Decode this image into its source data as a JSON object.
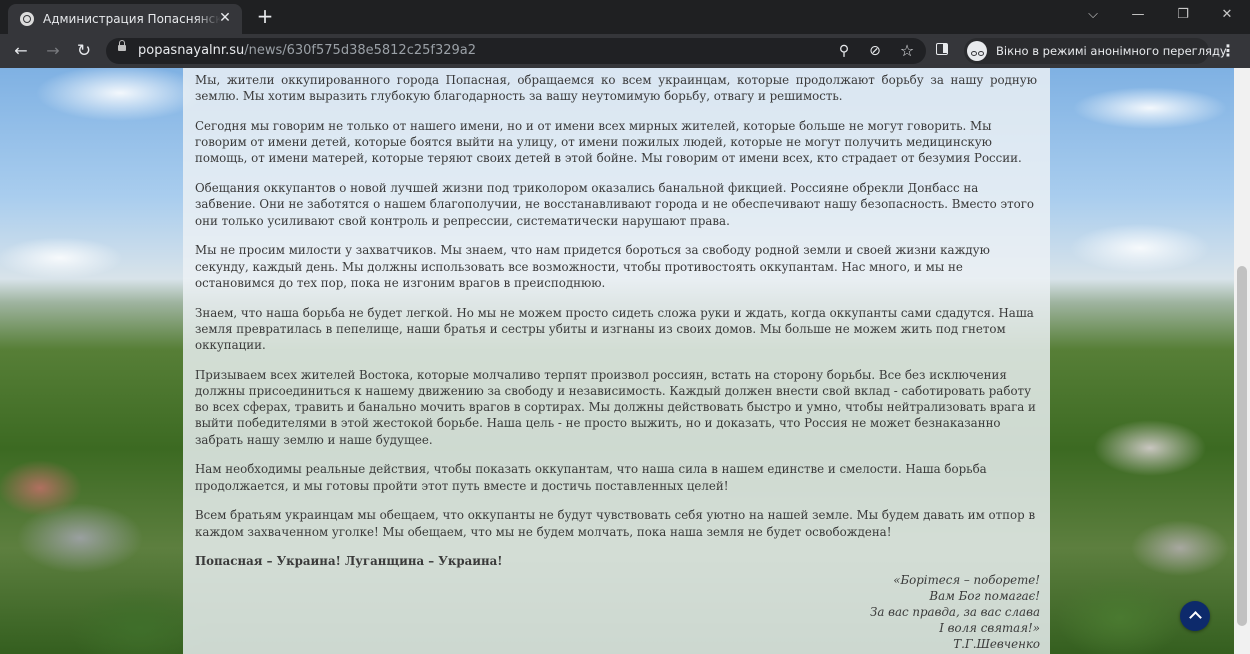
{
  "browser": {
    "tab_title": "Администрация Попаснянского",
    "close_glyph": "✕",
    "new_tab_glyph": "+",
    "url_host": "popasnayalnr.su",
    "url_path": "/news/630f575d38e5812c25f329a2",
    "incognito_label": "Вікно в режимі анонімного перегляду",
    "window_controls": {
      "chevron": "⌵",
      "minimize": "—",
      "restore": "❐",
      "close": "✕"
    },
    "icons": {
      "back": "←",
      "forward": "→",
      "reload": "↻",
      "search": "⚲",
      "eye_off": "⊘",
      "star": "☆",
      "menu": "⋮"
    }
  },
  "article": {
    "paragraphs": [
      "Мы, жители оккупированного города Попасная, обращаемся ко всем украинцам, которые продолжают борьбу за нашу родную землю. Мы хотим выразить глубокую благодарность за вашу неутомимую борьбу, отвагу и решимость.",
      "Сегодня мы говорим не только от нашего имени, но и от имени всех мирных жителей, которые больше не могут говорить. Мы говорим от имени детей, которые боятся выйти на улицу, от имени пожилых людей, которые не могут получить медицинскую помощь, от имени матерей, которые теряют своих детей в этой бойне. Мы говорим от имени всех, кто страдает от безумия России.",
      "Обещания оккупантов о новой лучшей жизни под триколором оказались банальной фикцией. Россияне обрекли Донбасс на забвение. Они не заботятся о нашем благополучии, не восстанавливают города и не обеспечивают нашу безопасность. Вместо этого они только усиливают свой контроль и репрессии, систематически нарушают права.",
      "Мы не просим милости у захватчиков. Мы знаем, что нам придется бороться за свободу родной земли и своей жизни каждую секунду, каждый день. Мы должны использовать все возможности, чтобы противостоять оккупантам. Нас много, и мы не остановимся до тех пор, пока не изгоним врагов в преисподнюю.",
      "Знаем, что наша борьба не будет легкой. Но мы не можем просто сидеть сложа руки и ждать, когда оккупанты сами сдадутся. Наша земля превратилась в пепелище, наши братья и сестры убиты и изгнаны из своих домов. Мы больше не можем жить под гнетом оккупации.",
      "Призываем всех жителей Востока, которые молчаливо терпят произвол россиян, встать на сторону борьбы. Все без исключения должны присоединиться к нашему движению за свободу и независимость. Каждый должен внести свой вклад - саботировать работу во всех сферах, травить и банально мочить врагов в сортирах. Мы должны действовать быстро и умно, чтобы нейтрализовать врага и выйти победителями в этой жестокой борьбе. Наша цель - не просто выжить, но и доказать, что Россия не может безнаказанно забрать нашу землю и наше будущее.",
      "Нам необходимы реальные действия, чтобы показать оккупантам, что наша сила в нашем единстве и смелости. Наша борьба продолжается, и мы готовы пройти этот путь вместе и достичь поставленных целей!",
      "Всем братьям украинцам мы обещаем, что оккупанты не будут чувствовать себя уютно на нашей земле. Мы будем давать им отпор в каждом захваченном уголке! Мы обещаем, что мы не будем молчать, пока наша земля не будет освобождена!",
      "Попасная – Украина! Луганщина – Украина!"
    ],
    "poem": [
      "«Борітеся – поборете!",
      "Вам Бог помагає!",
      "За вас правда, за вас слава",
      "І воля святая!»",
      "Т.Г.Шевченко"
    ]
  }
}
